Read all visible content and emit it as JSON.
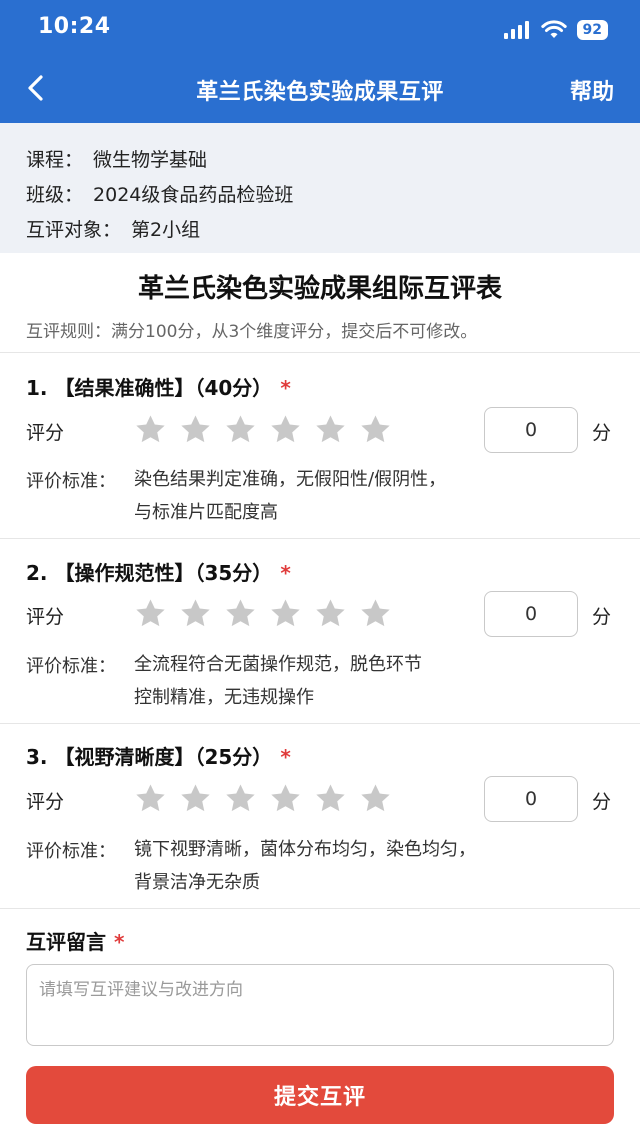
{
  "status_bar": {
    "time": "10:24",
    "battery": "92"
  },
  "nav": {
    "title": "革兰氏染色实验成果互评",
    "help": "帮助"
  },
  "info": {
    "course_label": "课程：",
    "course": "微生物学基础",
    "class_label": "班级：",
    "class": "2024级食品药品检验班",
    "target_label": "互评对象：",
    "target": "第2小组"
  },
  "form": {
    "title": "革兰氏染色实验成果组际互评表",
    "rule": "互评规则：满分100分，从3个维度评分，提交后不可修改。"
  },
  "dimensions": [
    {
      "title": "1. 【结果准确性】（40分）",
      "score_label": "评分",
      "stars_filled": 0,
      "stars_total": 6,
      "score_value": "0",
      "unit": "分",
      "criteria_label": "评价标准：",
      "criteria_line1": "染色结果判定准确，无假阳性/假阴性，",
      "criteria_line2": "与标准片匹配度高"
    },
    {
      "title": "2. 【操作规范性】（35分）",
      "score_label": "评分",
      "stars_filled": 0,
      "stars_total": 6,
      "score_value": "0",
      "unit": "分",
      "criteria_label": "评价标准：",
      "criteria_line1": "全流程符合无菌操作规范，脱色环节",
      "criteria_line2": "控制精准，无违规操作"
    },
    {
      "title": "3. 【视野清晰度】（25分）",
      "score_label": "评分",
      "stars_filled": 0,
      "stars_total": 6,
      "score_value": "0",
      "unit": "分",
      "criteria_label": "评价标准：",
      "criteria_line1": "镜下视野清晰，菌体分布均匀，染色均匀，",
      "criteria_line2": "背景洁净无杂质"
    }
  ],
  "comment": {
    "label": "互评留言",
    "placeholder": "请填写互评建议与改进方向",
    "value": ""
  },
  "submit_label": "提交互评",
  "required_mark": "*",
  "colors": {
    "primary": "#2a6fd0",
    "danger": "#e34a3c",
    "star_empty": "#c8c8c8"
  },
  "icons": {
    "back": "chevron-left-icon",
    "signal": "signal-icon",
    "wifi": "wifi-icon",
    "star": "star-icon"
  }
}
